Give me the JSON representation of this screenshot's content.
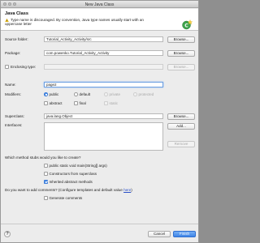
{
  "window": {
    "title": "New Java Class"
  },
  "header": {
    "title": "Java Class",
    "message": "Type name is discouraged. By convention, Java type names usually start with an uppercase letter"
  },
  "form": {
    "source_folder_label": "Source folder:",
    "source_folder_value": "Tutorial_Activity_Activity/src",
    "package_label": "Package:",
    "package_value": "com.powenko.Tutorial_Activity_Activity",
    "enclosing_type_label": "Enclosing type:",
    "enclosing_type_value": "",
    "name_label": "Name:",
    "name_value": "page2",
    "modifiers_label": "Modifiers:",
    "modifiers": {
      "public": "public",
      "default": "default",
      "private": "private",
      "protected": "protected",
      "abstract": "abstract",
      "final": "final",
      "static": "static"
    },
    "superclass_label": "Superclass:",
    "superclass_value": "java.lang.Object",
    "interfaces_label": "Interfaces:"
  },
  "buttons": {
    "browse": "Browse...",
    "add": "Add...",
    "remove": "Remove",
    "cancel": "Cancel",
    "finish": "Finish"
  },
  "stubs": {
    "question": "Which method stubs would you like to create?",
    "main": "public static void main(String[] args)",
    "constructors": "Constructors from superclass",
    "inherited": "Inherited abstract methods"
  },
  "comments": {
    "question": "Do you want to add comments? (Configure templates and default value ",
    "link": "here",
    "question_end": ")",
    "generate": "Generate comments"
  },
  "state": {
    "modifier_selected": "public",
    "main_checked": false,
    "constructors_checked": false,
    "inherited_checked": true,
    "generate_comments_checked": false,
    "enclosing_checked": false
  },
  "colors": {
    "accent": "#4c8fea",
    "link": "#2a4fc7"
  },
  "icons": {
    "warning": "warning-icon",
    "wizard": "new-class-wizard-icon",
    "help": "help-icon"
  }
}
